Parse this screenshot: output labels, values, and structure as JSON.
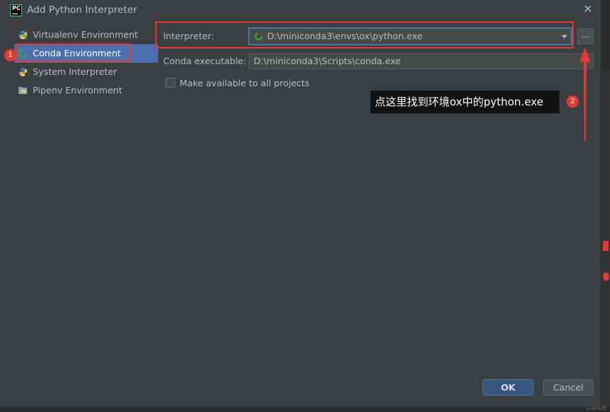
{
  "window": {
    "title": "Add Python Interpreter",
    "close_label": "✕",
    "logo_text": "PC"
  },
  "sidebar": {
    "items": [
      {
        "label": "Virtualenv Environment",
        "icon": "python-virtualenv-icon"
      },
      {
        "label": "Conda Environment",
        "icon": "conda-icon",
        "selected": true
      },
      {
        "label": "System Interpreter",
        "icon": "python-icon"
      },
      {
        "label": "Pipenv Environment",
        "icon": "pipenv-icon"
      }
    ]
  },
  "form": {
    "interpreter_label": "Interpreter:",
    "interpreter_value": "D:\\miniconda3\\envs\\ox\\python.exe",
    "browse_label": "...",
    "conda_label": "Conda executable:",
    "conda_value": "D:\\miniconda3\\Scripts\\conda.exe",
    "make_available_label": "Make available to all projects",
    "make_available_checked": false
  },
  "annotations": {
    "badge1": "1",
    "badge2": "2",
    "tooltip": "点这里找到环境ox中的python.exe"
  },
  "buttons": {
    "ok": "OK",
    "cancel": "Cancel"
  },
  "background": {
    "ghost_text": "Cance"
  },
  "colors": {
    "accent_selection": "#4b6eaf",
    "annotation_red": "#e53935",
    "ok_button": "#365880"
  }
}
